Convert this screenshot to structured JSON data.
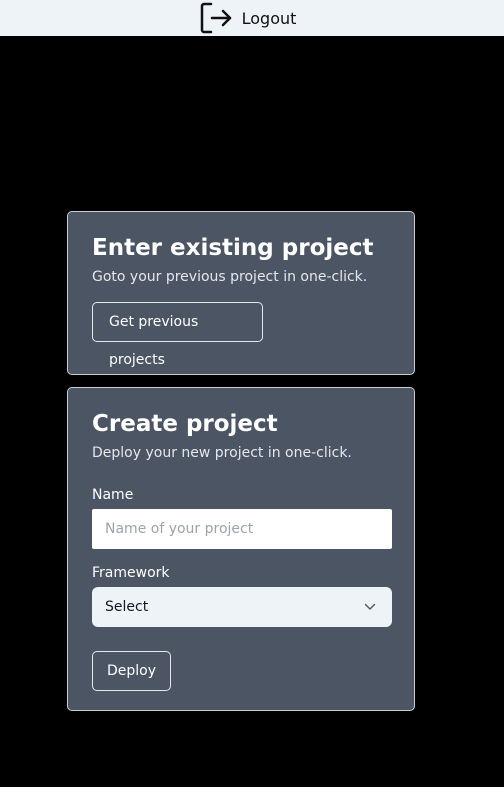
{
  "header": {
    "logout_label": "Logout",
    "logout_icon": "logout-icon"
  },
  "existing_project": {
    "title": "Enter existing project",
    "subtitle": "Goto your previous project in one-click.",
    "button_label": "Get previous projects"
  },
  "create_project": {
    "title": "Create project",
    "subtitle": "Deploy your new project in one-click.",
    "name_label": "Name",
    "name_placeholder": "Name of your project",
    "name_value": "",
    "framework_label": "Framework",
    "framework_selected": "Select",
    "deploy_label": "Deploy"
  },
  "colors": {
    "background": "#000000",
    "topbar": "#eef3f8",
    "card": "#4b5563",
    "card_border": "#c9ced6",
    "select_bg": "#eef3f8"
  }
}
